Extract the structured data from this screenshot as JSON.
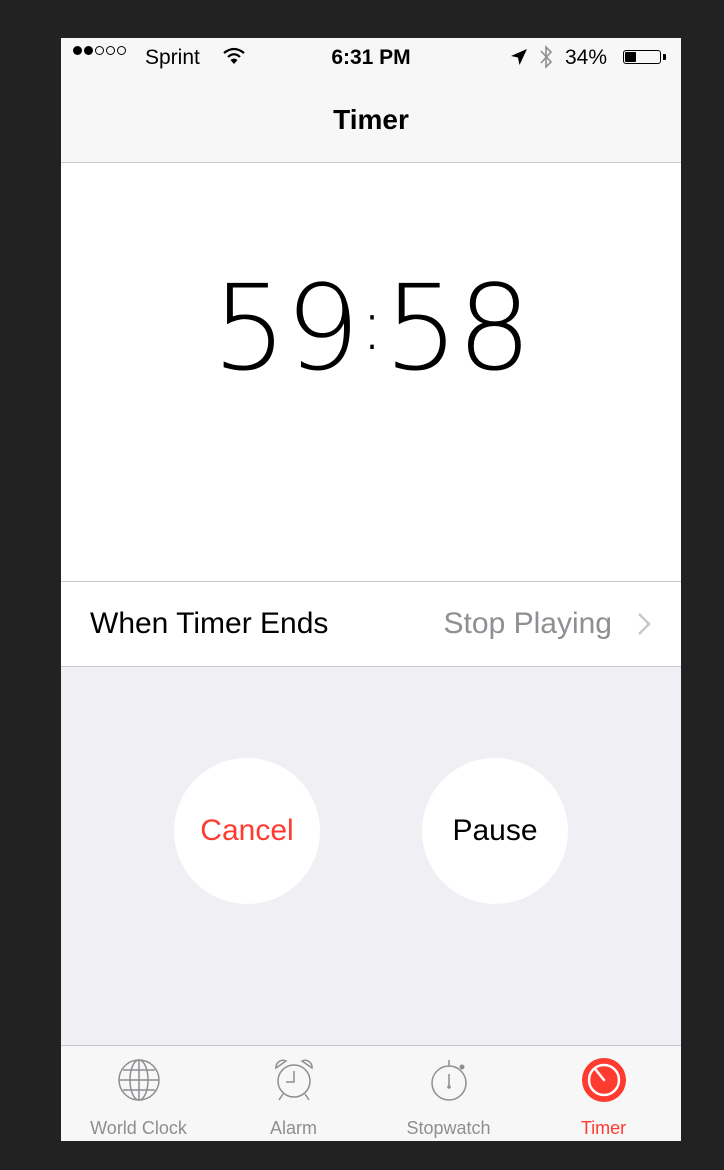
{
  "status_bar": {
    "carrier": "Sprint",
    "time": "6:31 PM",
    "battery": "34%",
    "battery_level": 0.34,
    "signal_bars": 2,
    "signal_total": 5
  },
  "nav": {
    "title": "Timer"
  },
  "timer": {
    "remaining": "59:58"
  },
  "settings": {
    "ends_label": "When Timer Ends",
    "ends_value": "Stop Playing"
  },
  "buttons": {
    "cancel": "Cancel",
    "pause": "Pause"
  },
  "tabs": [
    {
      "label": "World Clock",
      "icon": "globe-icon",
      "active": false
    },
    {
      "label": "Alarm",
      "icon": "alarm-clock-icon",
      "active": false
    },
    {
      "label": "Stopwatch",
      "icon": "stopwatch-icon",
      "active": false
    },
    {
      "label": "Timer",
      "icon": "timer-icon",
      "active": true
    }
  ],
  "colors": {
    "accent": "#ff3b30",
    "secondary_text": "#8e8e93",
    "group_background": "#efeff4"
  }
}
